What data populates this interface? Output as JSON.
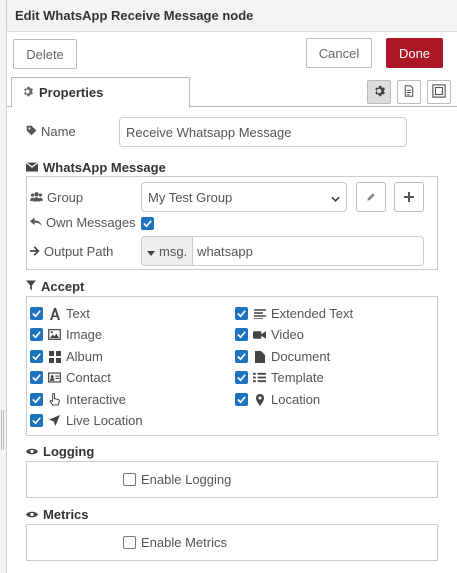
{
  "header": {
    "title": "Edit WhatsApp Receive Message node"
  },
  "toolbar": {
    "delete_label": "Delete",
    "cancel_label": "Cancel",
    "done_label": "Done"
  },
  "tabs": {
    "properties_label": "Properties"
  },
  "form": {
    "name_label": "Name",
    "name_value": "Receive Whatsapp Message",
    "whatsapp_section": "WhatsApp Message",
    "group_label": "Group",
    "group_value": "My Test Group",
    "own_messages_label": "Own Messages",
    "own_messages_checked": true,
    "output_path_label": "Output Path",
    "output_prefix": "msg.",
    "output_value": "whatsapp"
  },
  "accept": {
    "title": "Accept",
    "items": [
      {
        "label": "Text",
        "icon": "font-icon",
        "checked": true
      },
      {
        "label": "Extended Text",
        "icon": "align-left-icon",
        "checked": true
      },
      {
        "label": "Image",
        "icon": "image-icon",
        "checked": true
      },
      {
        "label": "Video",
        "icon": "video-camera-icon",
        "checked": true
      },
      {
        "label": "Album",
        "icon": "th-large-icon",
        "checked": true
      },
      {
        "label": "Document",
        "icon": "file-icon",
        "checked": true
      },
      {
        "label": "Contact",
        "icon": "address-card-icon",
        "checked": true
      },
      {
        "label": "Template",
        "icon": "list-icon",
        "checked": true
      },
      {
        "label": "Interactive",
        "icon": "hand-pointer-icon",
        "checked": true
      },
      {
        "label": "Location",
        "icon": "map-marker-icon",
        "checked": true
      },
      {
        "label": "Live Location",
        "icon": "location-arrow-icon",
        "checked": true
      }
    ]
  },
  "logging": {
    "title": "Logging",
    "enable_label": "Enable Logging",
    "checked": false
  },
  "metrics": {
    "title": "Metrics",
    "enable_label": "Enable Metrics",
    "checked": false
  },
  "colors": {
    "accent": "#1e73be",
    "done": "#ad1625"
  }
}
